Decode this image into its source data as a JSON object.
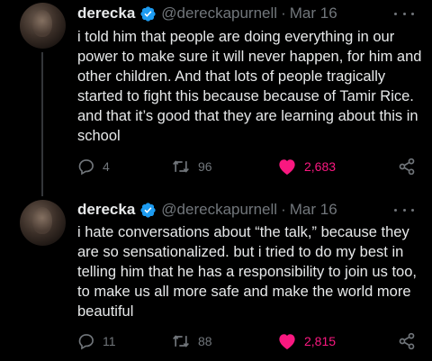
{
  "tweets": [
    {
      "display_name": "derecka",
      "handle": "@dereckapurnell",
      "separator": "·",
      "date": "Mar 16",
      "text": "i told him that people are doing everything in our power to make sure it will never happen, for him and other children. And that lots of people tragically started to fight this because because of Tamir Rice. and that it’s good that they are learning about this in school",
      "replies": "4",
      "retweets": "96",
      "likes": "2,683"
    },
    {
      "display_name": "derecka",
      "handle": "@dereckapurnell",
      "separator": "·",
      "date": "Mar 16",
      "text": "i hate conversations about “the talk,” because they are so sensationalized. but i tried to do my best in telling him that he has a responsibility to join us too, to make us all more safe and make the world more beautiful",
      "replies": "11",
      "retweets": "88",
      "likes": "2,815"
    }
  ],
  "colors": {
    "background": "#000000",
    "text": "#e7e9ea",
    "muted": "#71767b",
    "verified": "#1d9bf0",
    "like": "#f91880"
  },
  "icons": [
    "avatar",
    "verified-badge-icon",
    "more-icon",
    "reply-icon",
    "retweet-icon",
    "like-heart-icon",
    "share-icon"
  ]
}
